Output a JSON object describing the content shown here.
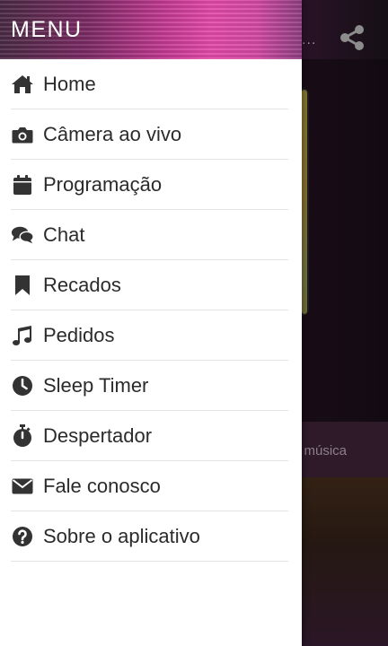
{
  "drawer": {
    "title": "MENU",
    "items": [
      {
        "label": "Home",
        "icon": "home-icon"
      },
      {
        "label": "Câmera ao vivo",
        "icon": "camera-icon"
      },
      {
        "label": "Programação",
        "icon": "calendar-icon"
      },
      {
        "label": "Chat",
        "icon": "chat-icon"
      },
      {
        "label": "Recados",
        "icon": "bookmark-icon"
      },
      {
        "label": "Pedidos",
        "icon": "music-note-icon"
      },
      {
        "label": "Sleep Timer",
        "icon": "clock-icon"
      },
      {
        "label": "Despertador",
        "icon": "stopwatch-icon"
      },
      {
        "label": "Fale conosco",
        "icon": "envelope-icon"
      },
      {
        "label": "Sobre o aplicativo",
        "icon": "question-circle-icon"
      }
    ]
  },
  "background": {
    "title_tail": "...",
    "song_text_tail": "a música",
    "share_icon": "share-icon"
  },
  "colors": {
    "drawer_bg": "#ffffff",
    "text": "#2b2b2b",
    "header_pink": "#e34aa8"
  }
}
